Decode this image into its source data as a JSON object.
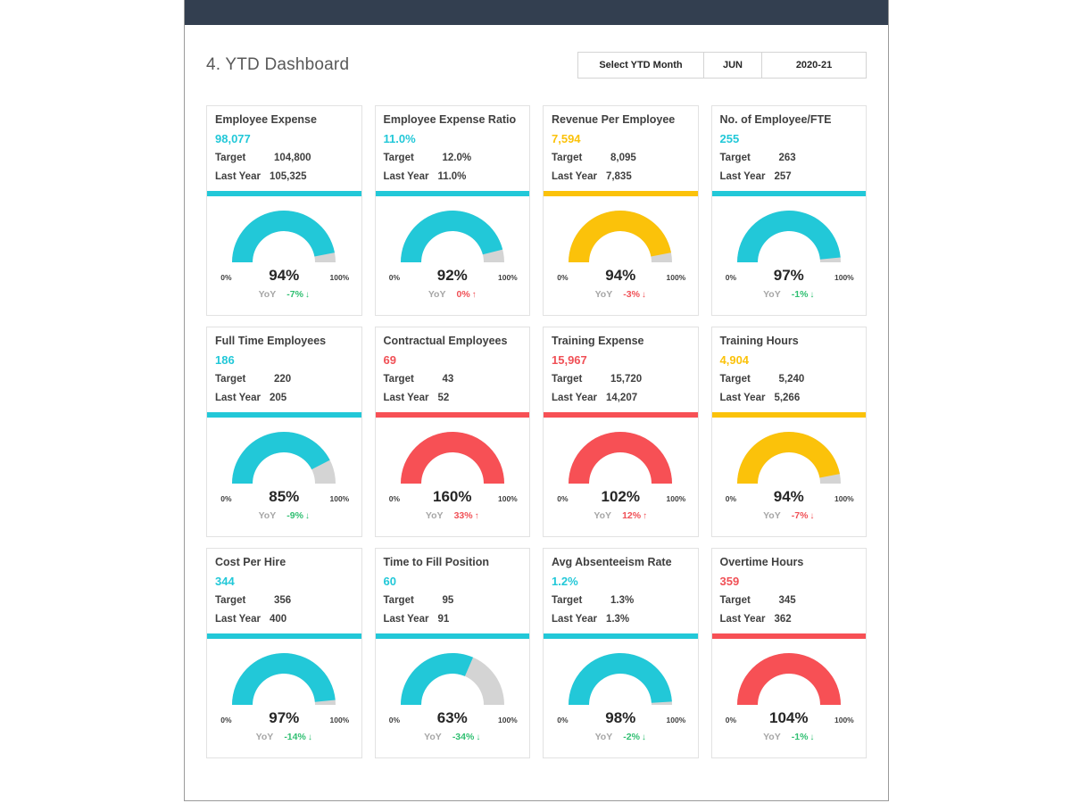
{
  "window": {
    "topbar_color": "#333f50",
    "page_background": "#ffffff"
  },
  "header": {
    "title": "4. YTD Dashboard",
    "selector": {
      "label": "Select YTD Month",
      "month": "JUN",
      "year": "2020-21"
    }
  },
  "palette": {
    "cyan": "#22c8d8",
    "amber": "#fbc20a",
    "red": "#f75055",
    "track": "#d4d4d4",
    "green_text": "#2fbf71",
    "red_text": "#f05056",
    "dark_text": "#404040",
    "muted_text": "#a6a6a6"
  },
  "labels": {
    "target": "Target",
    "last_year": "Last Year",
    "yoy": "YoY",
    "gauge_min": "0%",
    "gauge_max": "100%",
    "arrow_up": "↑",
    "arrow_down": "↓"
  },
  "chart_data": {
    "type": "gauge-grid",
    "title": "4. YTD Dashboard",
    "period": "JUN 2020-21",
    "gauge_axis": {
      "min_label": "0%",
      "max_label": "100%",
      "min": 0,
      "max": 100
    },
    "cards": [
      {
        "title": "Employee Expense",
        "value": "98,077",
        "value_color": "#22c8d8",
        "target": "104,800",
        "last_year": "105,325",
        "accent": "#22c8d8",
        "gauge_percent_label": "94%",
        "gauge_percent": 94,
        "gauge_color": "#22c8d8",
        "yoy": "-7%",
        "yoy_direction": "down",
        "yoy_color": "#2fbf71"
      },
      {
        "title": "Employee Expense Ratio",
        "value": "11.0%",
        "value_color": "#22c8d8",
        "target": "12.0%",
        "last_year": "11.0%",
        "accent": "#22c8d8",
        "gauge_percent_label": "92%",
        "gauge_percent": 92,
        "gauge_color": "#22c8d8",
        "yoy": "0%",
        "yoy_direction": "up",
        "yoy_color": "#f05056"
      },
      {
        "title": "Revenue Per Employee",
        "value": "7,594",
        "value_color": "#fbc20a",
        "target": "8,095",
        "last_year": "7,835",
        "accent": "#fbc20a",
        "gauge_percent_label": "94%",
        "gauge_percent": 94,
        "gauge_color": "#fbc20a",
        "yoy": "-3%",
        "yoy_direction": "down",
        "yoy_color": "#f05056"
      },
      {
        "title": "No. of Employee/FTE",
        "value": "255",
        "value_color": "#22c8d8",
        "target": "263",
        "last_year": "257",
        "accent": "#22c8d8",
        "gauge_percent_label": "97%",
        "gauge_percent": 97,
        "gauge_color": "#22c8d8",
        "yoy": "-1%",
        "yoy_direction": "down",
        "yoy_color": "#2fbf71"
      },
      {
        "title": "Full Time Employees",
        "value": "186",
        "value_color": "#22c8d8",
        "target": "220",
        "last_year": "205",
        "accent": "#22c8d8",
        "gauge_percent_label": "85%",
        "gauge_percent": 85,
        "gauge_color": "#22c8d8",
        "yoy": "-9%",
        "yoy_direction": "down",
        "yoy_color": "#2fbf71"
      },
      {
        "title": "Contractual Employees",
        "value": "69",
        "value_color": "#f05056",
        "target": "43",
        "last_year": "52",
        "accent": "#f75055",
        "gauge_percent_label": "160%",
        "gauge_percent": 160,
        "gauge_color": "#f75055",
        "yoy": "33%",
        "yoy_direction": "up",
        "yoy_color": "#f05056"
      },
      {
        "title": "Training Expense",
        "value": "15,967",
        "value_color": "#f05056",
        "target": "15,720",
        "last_year": "14,207",
        "accent": "#f75055",
        "gauge_percent_label": "102%",
        "gauge_percent": 102,
        "gauge_color": "#f75055",
        "yoy": "12%",
        "yoy_direction": "up",
        "yoy_color": "#f05056"
      },
      {
        "title": "Training Hours",
        "value": "4,904",
        "value_color": "#fbc20a",
        "target": "5,240",
        "last_year": "5,266",
        "accent": "#fbc20a",
        "gauge_percent_label": "94%",
        "gauge_percent": 94,
        "gauge_color": "#fbc20a",
        "yoy": "-7%",
        "yoy_direction": "down",
        "yoy_color": "#f05056"
      },
      {
        "title": "Cost Per Hire",
        "value": "344",
        "value_color": "#22c8d8",
        "target": "356",
        "last_year": "400",
        "accent": "#22c8d8",
        "gauge_percent_label": "97%",
        "gauge_percent": 97,
        "gauge_color": "#22c8d8",
        "yoy": "-14%",
        "yoy_direction": "down",
        "yoy_color": "#2fbf71"
      },
      {
        "title": "Time to Fill Position",
        "value": "60",
        "value_color": "#22c8d8",
        "target": "95",
        "last_year": "91",
        "accent": "#22c8d8",
        "gauge_percent_label": "63%",
        "gauge_percent": 63,
        "gauge_color": "#22c8d8",
        "yoy": "-34%",
        "yoy_direction": "down",
        "yoy_color": "#2fbf71"
      },
      {
        "title": "Avg Absenteeism Rate",
        "value": "1.2%",
        "value_color": "#22c8d8",
        "target": "1.3%",
        "last_year": "1.3%",
        "accent": "#22c8d8",
        "gauge_percent_label": "98%",
        "gauge_percent": 98,
        "gauge_color": "#22c8d8",
        "yoy": "-2%",
        "yoy_direction": "down",
        "yoy_color": "#2fbf71"
      },
      {
        "title": "Overtime Hours",
        "value": "359",
        "value_color": "#f05056",
        "target": "345",
        "last_year": "362",
        "accent": "#f75055",
        "gauge_percent_label": "104%",
        "gauge_percent": 104,
        "gauge_color": "#f75055",
        "yoy": "-1%",
        "yoy_direction": "down",
        "yoy_color": "#2fbf71"
      }
    ]
  }
}
